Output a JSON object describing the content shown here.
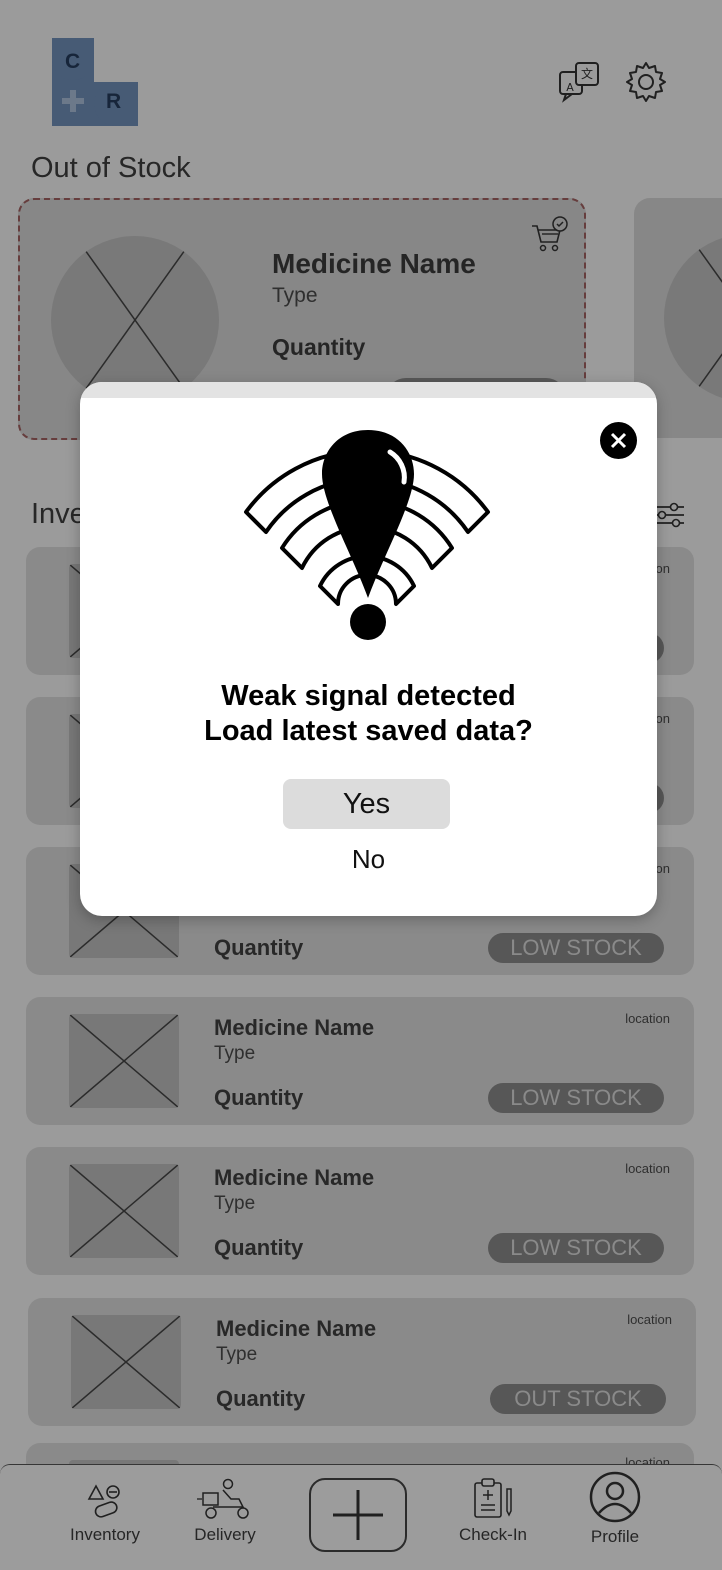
{
  "header": {
    "logo_letters": [
      "C",
      "R"
    ],
    "translate_icon": "translate-icon",
    "settings_icon": "gear-icon"
  },
  "out_of_stock": {
    "title": "Out of Stock",
    "card": {
      "name": "Medicine Name",
      "type": "Type",
      "quantity": "Quantity",
      "icon": "cart-check-icon"
    }
  },
  "inventory": {
    "title": "Inve",
    "filter_icon": "sliders-icon",
    "items": [
      {
        "name": "Medicine Name",
        "type": "Type",
        "quantity": "Quantity",
        "location": "location",
        "status": "LOW STOCK"
      },
      {
        "name": "Medicine Name",
        "type": "Type",
        "quantity": "Quantity",
        "location": "location",
        "status": "LOW STOCK"
      },
      {
        "name": "Medicine Name",
        "type": "Type",
        "quantity": "Quantity",
        "location": "location",
        "status": "OUT STOCK"
      },
      {
        "name": "",
        "type": "",
        "quantity": "",
        "location": "location",
        "status": ""
      }
    ],
    "partial_locations": [
      "on",
      "on",
      "on"
    ],
    "partial_status": "LOW STOCK",
    "partial_quantity": "Quantity"
  },
  "modal": {
    "line1": "Weak signal detected",
    "line2": "Load latest saved data?",
    "yes_label": "Yes",
    "no_label": "No",
    "icon": "weak-signal-warning-icon"
  },
  "bottom_nav": {
    "inventory": "Inventory",
    "delivery": "Delivery",
    "checkin": "Check-In",
    "profile": "Profile"
  },
  "colors": {
    "overlay": "#5c5c5c",
    "modal_bg": "#ffffff",
    "badge": "#888888"
  }
}
